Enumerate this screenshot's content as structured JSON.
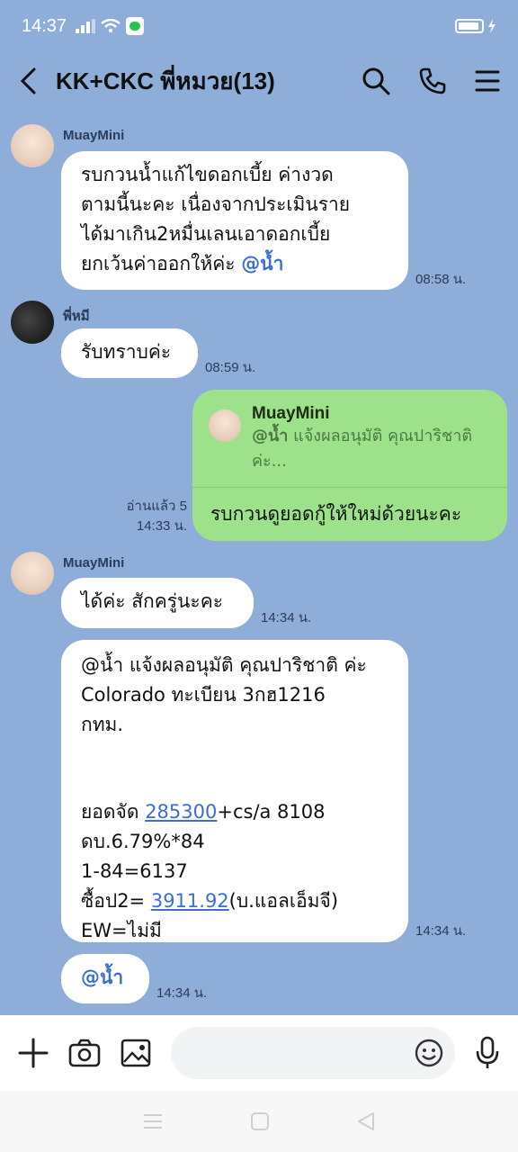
{
  "status_bar": {
    "time": "14:37"
  },
  "header": {
    "title": "KK+CKC พี่หมวย(13)"
  },
  "messages": {
    "m1": {
      "sender": "MuayMini",
      "lines": [
        "รบกวนน้ำแก้ไขดอกเบี้ย ค่างวด",
        "ตามนี้นะคะ เนื่องจากประเมินราย",
        "ได้มาเกิน2หมื่นเลนเอาดอกเบี้ย"
      ],
      "line4_text": "ยกเว้นค่าออกให้ค่ะ ",
      "line4_mention": "@น้ำ",
      "time": "08:58 น."
    },
    "m2": {
      "sender": "พี่หมี",
      "text": "รับทราบค่ะ",
      "time": "08:59 น."
    },
    "m3": {
      "reply_name": "MuayMini",
      "reply_mention": "@น้ำ",
      "reply_text": " แจ้งผลอนุมัติ คุณปาริชาติ",
      "reply_text2": "ค่ะ...",
      "text": "รบกวนดูยอดกู้ให้ใหม่ด้วยนะคะ",
      "read": "อ่านแล้ว 5",
      "time": "14:33 น."
    },
    "m4": {
      "sender": "MuayMini",
      "text": "ได้ค่ะ สักครู่นะคะ",
      "time": "14:34 น."
    },
    "m5": {
      "line1": "@น้ำ แจ้งผลอนุมัติ คุณปาริชาติ ค่ะ",
      "line2": "Colorado ทะเบียน 3กฮ1216",
      "line3": "กทม.",
      "line4_prefix": "ยอดจัด ",
      "line4_link": "285300",
      "line4_suffix": "+cs/a 8108",
      "line5": "ดบ.6.79%*84",
      "line6": "1-84=6137",
      "line7_prefix": "ซื้อป2= ",
      "line7_link": "3911.92",
      "line7_suffix": "(บ.แอลเอ็มจี)",
      "line8": "EW=ไม่มี",
      "time": "14:34 น."
    },
    "m6": {
      "text": "@น้ำ",
      "time": "14:34 น."
    }
  },
  "input": {
    "placeholder": ""
  },
  "icons": {
    "back": "back-arrow-icon",
    "search": "search-icon",
    "call": "phone-icon",
    "menu": "menu-icon",
    "add": "plus-icon",
    "camera": "camera-icon",
    "gallery": "image-icon",
    "emoji": "emoji-icon",
    "mic": "microphone-icon"
  },
  "colors": {
    "background": "#8fadd9",
    "outgoing": "#9de28a",
    "mention": "#3b6fd1"
  }
}
